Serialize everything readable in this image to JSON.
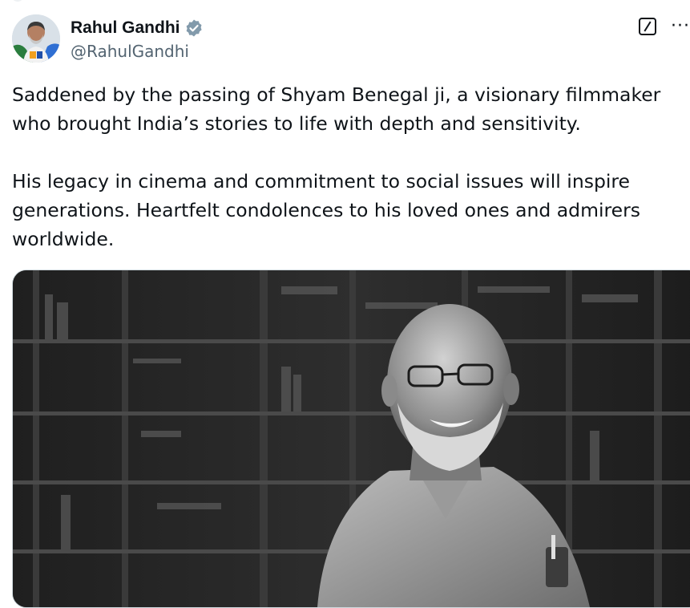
{
  "author": {
    "display_name": "Rahul Gandhi",
    "handle": "@RahulGandhi",
    "verified": true
  },
  "tweet": {
    "paragraphs": [
      "Saddened by the passing of Shyam Benegal ji, a visionary filmmaker who brought India’s stories to life with depth and sensitivity.",
      "His legacy in cinema and commitment to social issues will inspire generations. Heartfelt condolences to his loved ones and admirers worldwide."
    ]
  },
  "icons": {
    "verified": "verified-badge-icon",
    "grok": "grok-icon",
    "more": "more-options-icon"
  },
  "colors": {
    "text_primary": "#0f1419",
    "text_secondary": "#536471",
    "verified_badge": "#829aab"
  }
}
